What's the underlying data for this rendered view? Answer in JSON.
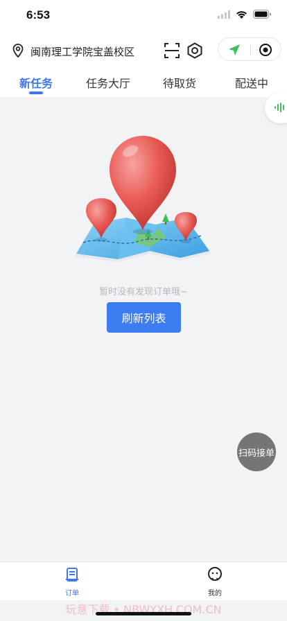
{
  "status_bar": {
    "time": "6:53"
  },
  "header": {
    "location": "闽南理工学院宝盖校区"
  },
  "tabs": [
    {
      "label": "新任务",
      "active": true
    },
    {
      "label": "任务大厅",
      "active": false
    },
    {
      "label": "待取货",
      "active": false
    },
    {
      "label": "配送中",
      "active": false
    }
  ],
  "empty_state": {
    "message": "暂时没有发现订单哦~",
    "refresh_label": "刷新列表"
  },
  "fab": {
    "label": "扫码接单"
  },
  "bottom_nav": [
    {
      "label": "订单",
      "icon": "order-icon",
      "active": true
    },
    {
      "label": "我的",
      "icon": "profile-icon",
      "active": false
    }
  ],
  "watermark": "玩意下载 • NBWYXH.COM.CN",
  "colors": {
    "accent": "#3c78e6",
    "button": "#3d7bf0",
    "fab": "#757575",
    "background": "#f2f3f5"
  }
}
